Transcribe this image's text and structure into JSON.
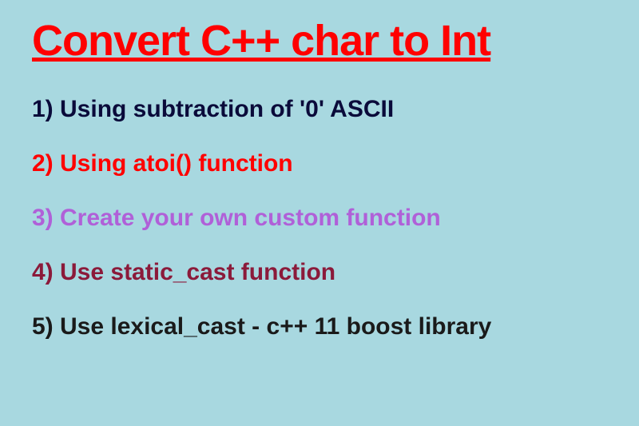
{
  "title": "Convert C++ char to Int",
  "items": [
    {
      "text": "1) Using subtraction of '0' ASCII",
      "colorClass": "color-darkblue"
    },
    {
      "text": "2) Using atoi() function",
      "colorClass": "color-red"
    },
    {
      "text": "3) Create your own custom function",
      "colorClass": "color-purple"
    },
    {
      "text": "4) Use static_cast function",
      "colorClass": "color-maroon"
    },
    {
      "text": "5) Use lexical_cast - c++ 11 boost library",
      "colorClass": "color-black"
    }
  ]
}
